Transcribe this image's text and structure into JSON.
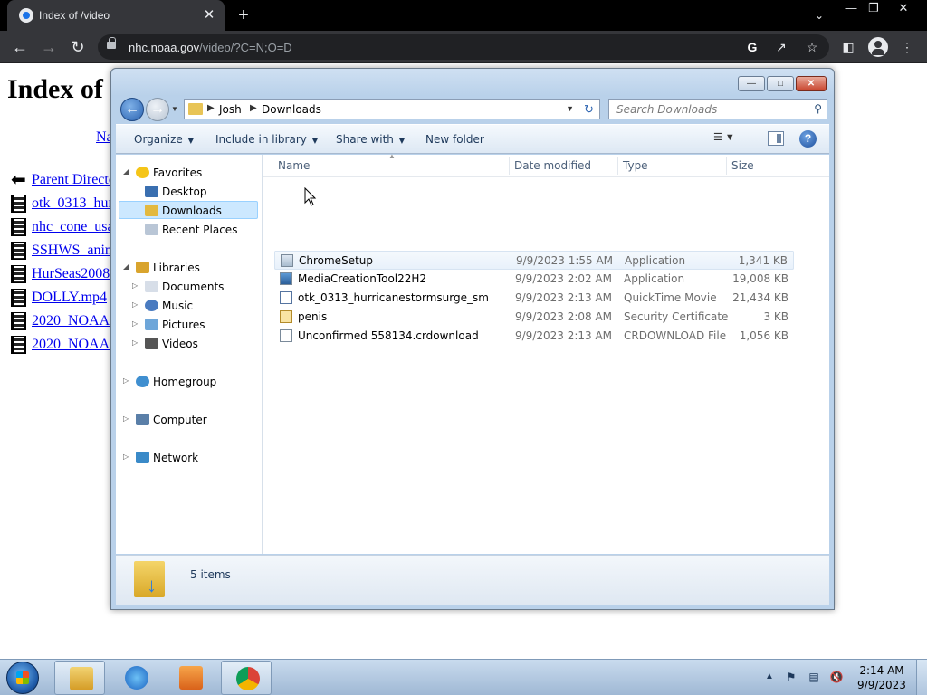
{
  "browser": {
    "tab_title": "Index of /video",
    "tab_close": "✕",
    "new_tab": "+",
    "url_host": "nhc.noaa.gov",
    "url_path": "/video/?C=N;O=D",
    "icons": [
      "noaa-favicon",
      "back-arrow",
      "forward-arrow",
      "reload",
      "lock",
      "google",
      "share",
      "star",
      "side-panel",
      "profile",
      "menu"
    ]
  },
  "webpage": {
    "title": "Index of",
    "column_link": "Na",
    "entries": [
      {
        "label": "Parent Directo",
        "icon": "back"
      },
      {
        "label": "otk_0313_hur",
        "icon": "film"
      },
      {
        "label": "nhc_cone_usa",
        "icon": "film"
      },
      {
        "label": "SSHWS_anim",
        "icon": "film"
      },
      {
        "label": "HurSeas2008",
        "icon": "film"
      },
      {
        "label": "DOLLY.mp4",
        "icon": "film"
      },
      {
        "label": "2020_NOAA",
        "icon": "film"
      },
      {
        "label": "2020_NOAA",
        "icon": "film"
      }
    ]
  },
  "explorer": {
    "breadcrumb": [
      "Josh",
      "Downloads"
    ],
    "search_placeholder": "Search Downloads",
    "toolbar": {
      "organize": "Organize",
      "include_in_library": "Include in library",
      "share_with": "Share with",
      "new_folder": "New folder"
    },
    "nav": {
      "favorites": "Favorites",
      "desktop": "Desktop",
      "downloads": "Downloads",
      "recent_places": "Recent Places",
      "libraries": "Libraries",
      "documents": "Documents",
      "music": "Music",
      "pictures": "Pictures",
      "videos": "Videos",
      "homegroup": "Homegroup",
      "computer": "Computer",
      "network": "Network"
    },
    "columns": {
      "name": "Name",
      "date_modified": "Date modified",
      "type": "Type",
      "size": "Size"
    },
    "files": [
      {
        "name": "ChromeSetup",
        "date": "9/9/2023 1:55 AM",
        "type": "Application",
        "size": "1,341 KB"
      },
      {
        "name": "MediaCreationTool22H2",
        "date": "9/9/2023 2:02 AM",
        "type": "Application",
        "size": "19,008 KB"
      },
      {
        "name": "otk_0313_hurricanestormsurge_sm",
        "date": "9/9/2023 2:13 AM",
        "type": "QuickTime Movie",
        "size": "21,434 KB"
      },
      {
        "name": "penis",
        "date": "9/9/2023 2:08 AM",
        "type": "Security Certificate",
        "size": "3 KB"
      },
      {
        "name": "Unconfirmed 558134.crdownload",
        "date": "9/9/2023 2:13 AM",
        "type": "CRDOWNLOAD File",
        "size": "1,056 KB"
      }
    ],
    "item_count": "5 items"
  },
  "taskbar": {
    "time": "2:14 AM",
    "date": "9/9/2023",
    "pinned": [
      "windows-explorer",
      "internet-explorer",
      "media-player",
      "google-chrome"
    ]
  }
}
